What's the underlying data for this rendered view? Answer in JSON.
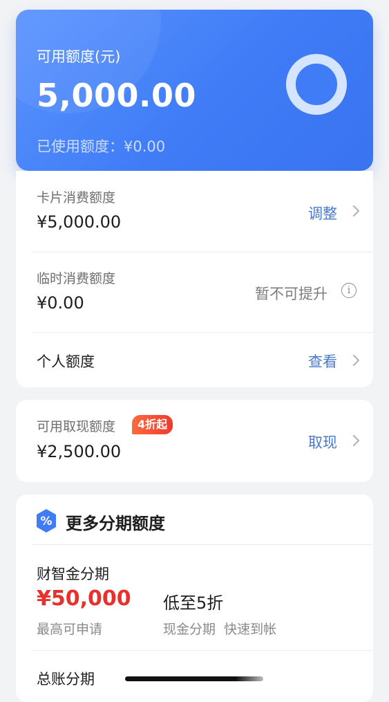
{
  "credit": {
    "label": "可用额度(元)",
    "amount": "5,000.00",
    "used": "已使用额度：¥0.00"
  },
  "card_limit": {
    "label": "卡片消费额度",
    "value": "¥5,000.00",
    "action": "调整"
  },
  "temp_limit": {
    "label": "临时消费额度",
    "value": "¥0.00",
    "status": "暂不可提升",
    "info_icon": "i"
  },
  "personal_limit": {
    "label": "个人额度",
    "action": "查看"
  },
  "cash_limit": {
    "label": "可用取现额度",
    "badge": "4折起",
    "value": "¥2,500.00",
    "action": "取现"
  },
  "installments": {
    "title": "更多分期额度",
    "icon": "%",
    "item1": {
      "name": "财智金分期",
      "amount": "¥50,000",
      "amount_note": "最高可申请",
      "rate": "低至5折",
      "features": "现金分期  快速到帐"
    },
    "item2": {
      "name": "总账分期"
    }
  },
  "colors": {
    "primary": "#3f7cf6",
    "action": "#4a78c9",
    "highlight": "#e8312c"
  }
}
